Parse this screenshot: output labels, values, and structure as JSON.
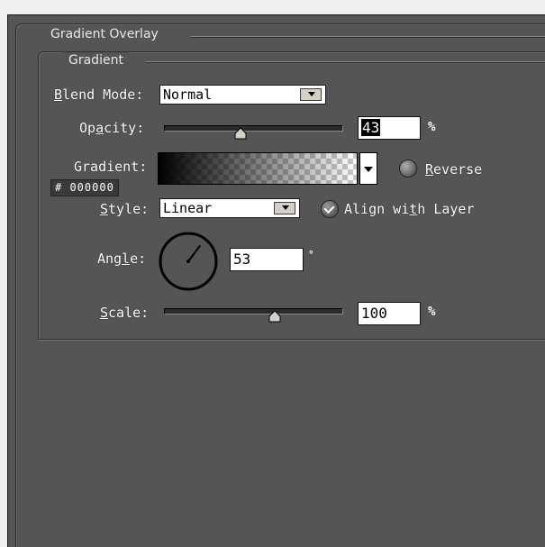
{
  "panel": {
    "section_title": "Gradient Overlay",
    "group_title": "Gradient"
  },
  "blend_mode": {
    "label_key": "B",
    "label_rest": "lend Mode:",
    "value": "Normal"
  },
  "opacity": {
    "label_pre": "Op",
    "label_key": "a",
    "label_post": "city:",
    "value": "43",
    "unit": "%",
    "level_percent": 43
  },
  "gradient": {
    "label": "Gradient:",
    "reverse_key": "R",
    "reverse_rest": "everse",
    "hex_code": "# 000000"
  },
  "style": {
    "label_key": "S",
    "label_rest": "tyle:",
    "value": "Linear",
    "align_label_pre": "Align wi",
    "align_label_key": "t",
    "align_label_post": "h Layer"
  },
  "angle": {
    "label_pre": "Ang",
    "label_key": "l",
    "label_post": "e:",
    "value": "53",
    "unit": "°",
    "degrees": 53
  },
  "scale": {
    "label_key": "S",
    "label_rest": "cale:",
    "value": "100",
    "unit": "%",
    "level_percent": 100
  },
  "colors": {
    "panel_bg": "#555555",
    "field_bg": "#ffffff",
    "text": "#ffffff"
  }
}
